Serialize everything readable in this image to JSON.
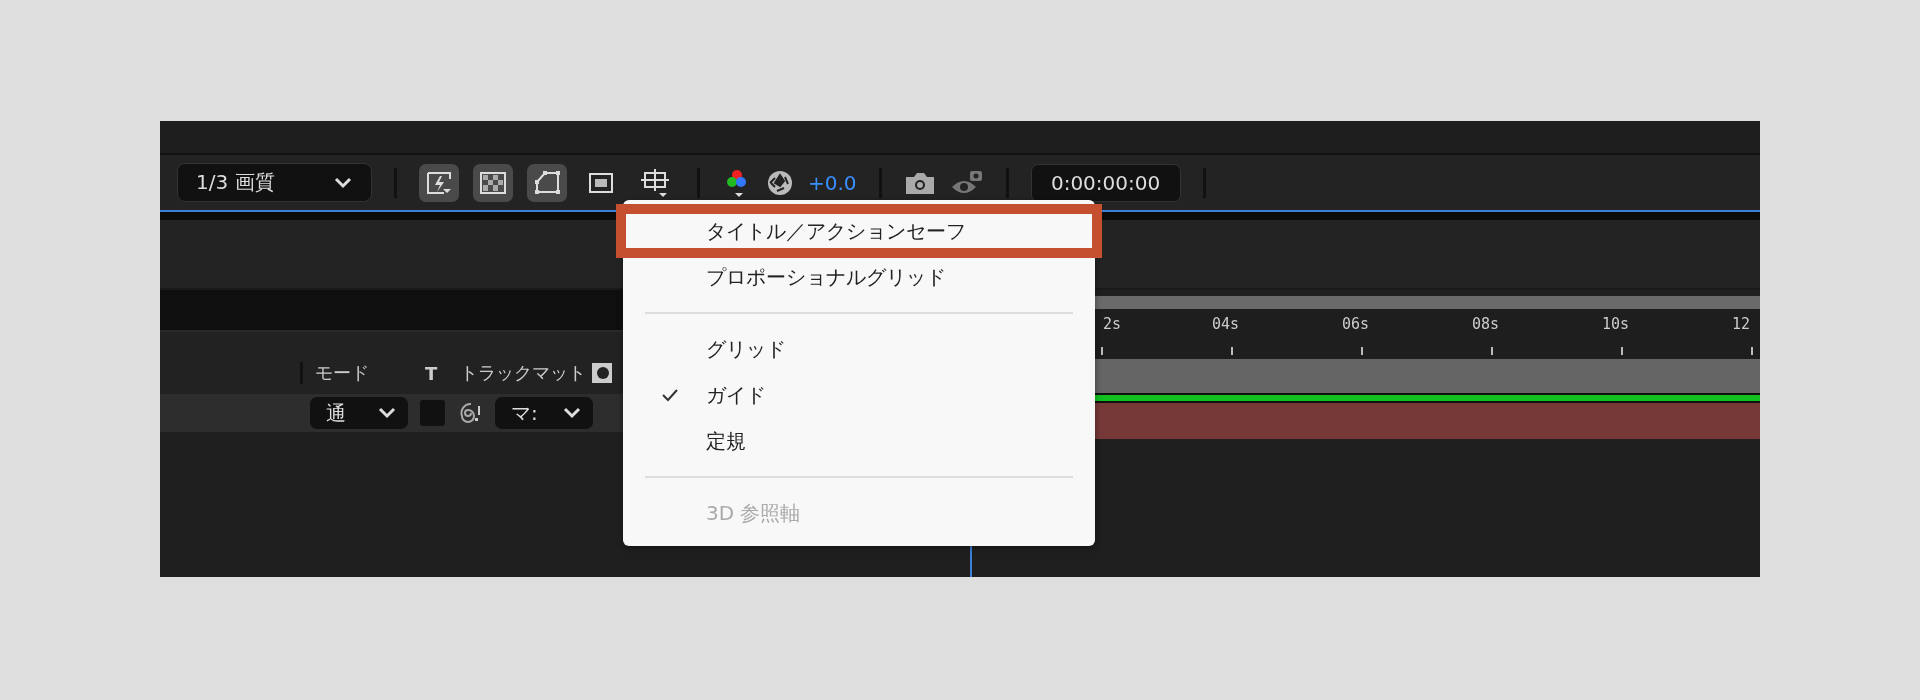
{
  "toolbar": {
    "quality": "1/3 画質",
    "buttons": [
      {
        "kind": "fast-preview",
        "on": true
      },
      {
        "kind": "transparency",
        "on": true
      },
      {
        "kind": "mask",
        "on": true
      },
      {
        "kind": "region",
        "on": false
      },
      {
        "kind": "grid",
        "on": false
      }
    ],
    "exposure": "+0.0",
    "timecode": "0:00:00:00"
  },
  "layer_header": {
    "mode": "モード",
    "t": "T",
    "track_matte": "トラックマット"
  },
  "layer_row": {
    "mode": "通",
    "checked": false,
    "matte": "マ:"
  },
  "ruler": [
    "2s",
    "04s",
    "06s",
    "08s",
    "10s",
    "12"
  ],
  "menu": {
    "items": [
      {
        "kind": "item",
        "label": "タイトル／アクションセーフ",
        "checked": false,
        "disabled": false,
        "highlighted": true
      },
      {
        "kind": "item",
        "label": "プロポーショナルグリッド",
        "checked": false,
        "disabled": false,
        "highlighted": false
      },
      {
        "kind": "separator"
      },
      {
        "kind": "item",
        "label": "グリッド",
        "checked": false,
        "disabled": false,
        "highlighted": false
      },
      {
        "kind": "item",
        "label": "ガイド",
        "checked": true,
        "disabled": false,
        "highlighted": false
      },
      {
        "kind": "item",
        "label": "定規",
        "checked": false,
        "disabled": false,
        "highlighted": false
      },
      {
        "kind": "separator"
      },
      {
        "kind": "item",
        "label": "3D 参照軸",
        "checked": false,
        "disabled": true,
        "highlighted": false
      }
    ]
  }
}
